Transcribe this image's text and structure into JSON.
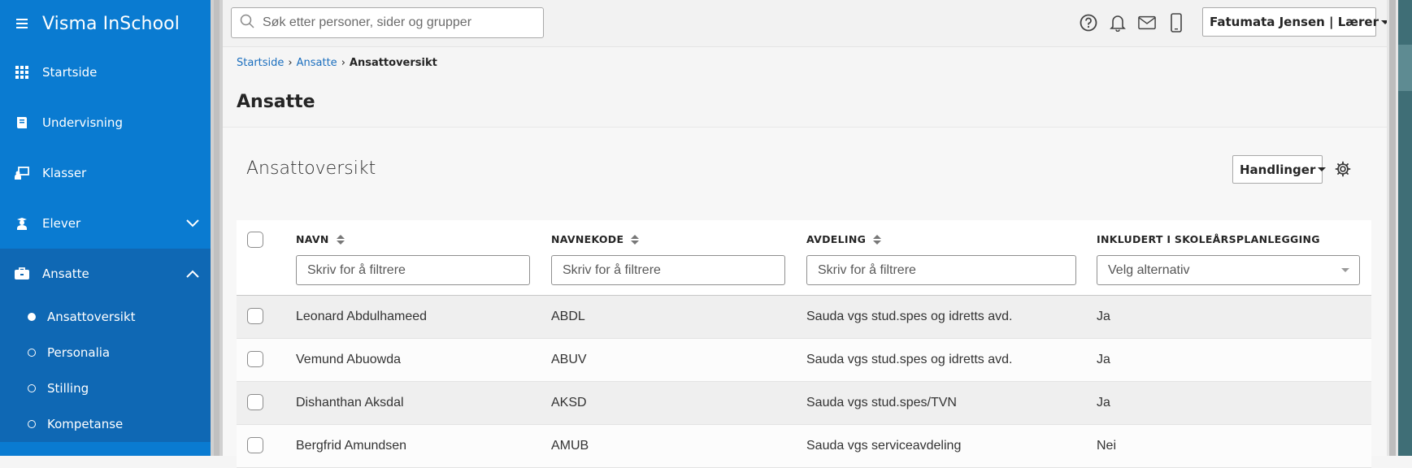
{
  "app": {
    "title": "Visma InSchool"
  },
  "sidebar": {
    "items": [
      {
        "label": "Startside",
        "icon": "grid-icon"
      },
      {
        "label": "Undervisning",
        "icon": "book-icon"
      },
      {
        "label": "Klasser",
        "icon": "classroom-icon"
      },
      {
        "label": "Elever",
        "icon": "student-icon"
      },
      {
        "label": "Ansatte",
        "icon": "briefcase-icon"
      }
    ],
    "subitems": [
      {
        "label": "Ansattoversikt",
        "active": true
      },
      {
        "label": "Personalia",
        "active": false
      },
      {
        "label": "Stilling",
        "active": false
      },
      {
        "label": "Kompetanse",
        "active": false
      }
    ]
  },
  "search": {
    "placeholder": "Søk etter personer, sider og grupper"
  },
  "user": {
    "label": "Fatumata Jensen | Lærer"
  },
  "breadcrumb": {
    "home": "Startside",
    "section": "Ansatte",
    "current": "Ansattoversikt"
  },
  "page": {
    "title": "Ansatte"
  },
  "panel": {
    "title": "Ansattoversikt",
    "actions_label": "Handlinger"
  },
  "table": {
    "columns": [
      {
        "label": "NAVN",
        "filter_placeholder": "Skriv for å filtrere"
      },
      {
        "label": "NAVNEKODE",
        "filter_placeholder": "Skriv for å filtrere"
      },
      {
        "label": "AVDELING",
        "filter_placeholder": "Skriv for å filtrere"
      },
      {
        "label": "INKLUDERT I SKOLEÅRSPLANLEGGING",
        "filter_placeholder": "Velg alternativ"
      }
    ],
    "rows": [
      {
        "name": "Leonard Abdulhameed",
        "code": "ABDL",
        "department": "Sauda vgs stud.spes og idretts avd.",
        "included": "Ja"
      },
      {
        "name": "Vemund Abuowda",
        "code": "ABUV",
        "department": "Sauda vgs stud.spes og idretts avd.",
        "included": "Ja"
      },
      {
        "name": "Dishanthan Aksdal",
        "code": "AKSD",
        "department": "Sauda vgs stud.spes/TVN",
        "included": "Ja"
      },
      {
        "name": "Bergfrid Amundsen",
        "code": "AMUB",
        "department": "Sauda vgs serviceavdeling",
        "included": "Nei"
      }
    ]
  },
  "colors": {
    "sidebar": "#0a7bd1",
    "sidebar_group": "#0f68b4",
    "link": "#1a6ebe"
  }
}
